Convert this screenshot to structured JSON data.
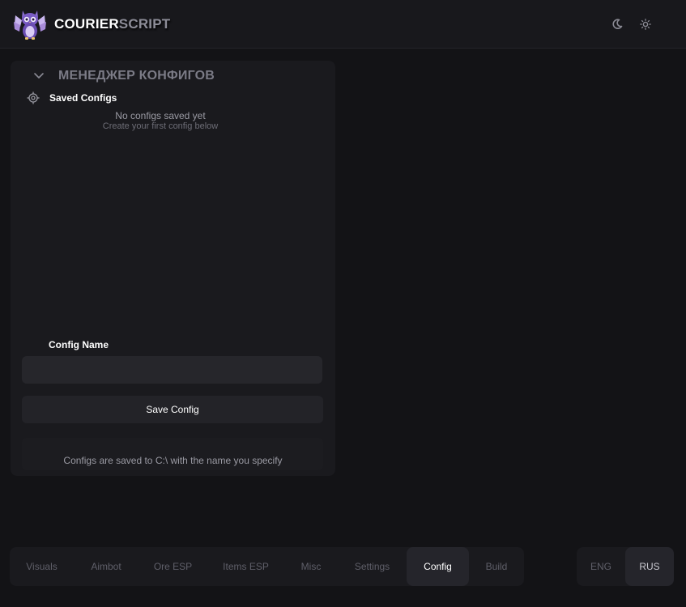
{
  "header": {
    "brand_primary": "COURIER",
    "brand_secondary": "SCRIPT",
    "logo_icon": "owl-mascot-logo",
    "theme_dark_icon": "moon-icon",
    "theme_light_icon": "sun-icon"
  },
  "config_panel": {
    "title": "МЕНЕДЖЕР КОНФИГОВ",
    "collapse_icon": "chevron-down-icon",
    "saved_configs_label": "Saved Configs",
    "saved_configs_icon": "target-icon",
    "empty_title": "No configs saved yet",
    "empty_subtitle": "Create your first config below",
    "config_name_label": "Config Name",
    "config_name_value": "",
    "save_button_label": "Save Config",
    "note": "Configs are saved to C:\\ with the name you specify"
  },
  "tabs": [
    {
      "label": "Visuals",
      "active": false
    },
    {
      "label": "Aimbot",
      "active": false
    },
    {
      "label": "Ore ESP",
      "active": false
    },
    {
      "label": "Items ESP",
      "active": false
    },
    {
      "label": "Misc",
      "active": false
    },
    {
      "label": "Settings",
      "active": false
    },
    {
      "label": "Config",
      "active": true
    },
    {
      "label": "Build",
      "active": false
    }
  ],
  "languages": [
    {
      "label": "ENG",
      "active": false
    },
    {
      "label": "RUS",
      "active": true
    }
  ],
  "colors": {
    "background": "#131316",
    "panel": "#1a1a1e",
    "accent_purple": "#8b6fd0",
    "text_primary": "#ffffff",
    "text_muted": "#5f5f69"
  }
}
